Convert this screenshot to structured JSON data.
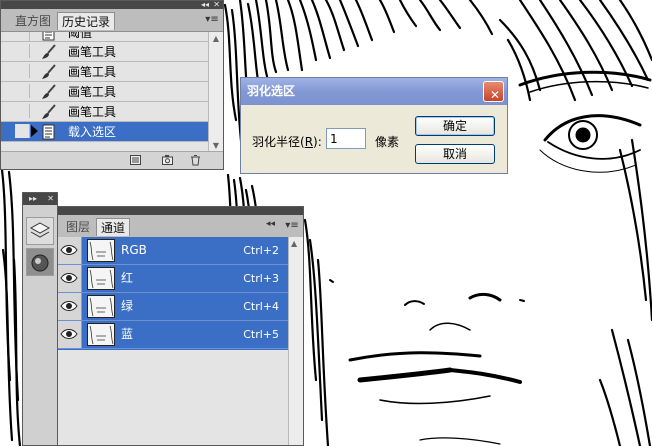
{
  "history_panel": {
    "collapse_glyph": "◂◂",
    "close_glyph": "✕",
    "tabs": [
      {
        "label": "直方图",
        "active": false
      },
      {
        "label": "历史记录",
        "active": true
      }
    ],
    "menu_glyph": "▾≡",
    "items": [
      {
        "label": "阈值",
        "icon": "history-state-icon",
        "selected": false
      },
      {
        "label": "画笔工具",
        "icon": "brush-icon",
        "selected": false
      },
      {
        "label": "画笔工具",
        "icon": "brush-icon",
        "selected": false
      },
      {
        "label": "画笔工具",
        "icon": "brush-icon",
        "selected": false
      },
      {
        "label": "画笔工具",
        "icon": "brush-icon",
        "selected": false
      },
      {
        "label": "载入选区",
        "icon": "history-state-icon",
        "selected": true
      }
    ],
    "footer_icons": [
      "new-document-from-state-icon",
      "snapshot-icon",
      "trash-icon"
    ]
  },
  "tool_strip": {
    "expand_glyph": "▸▸",
    "close_glyph": "✕",
    "buttons": [
      "layers-icon",
      "channels-icon"
    ]
  },
  "channels_panel": {
    "collapse_glyph": "◂◂",
    "tabs": [
      {
        "label": "图层",
        "active": false
      },
      {
        "label": "通道",
        "active": true
      }
    ],
    "menu_glyph": "▾≡",
    "channels": [
      {
        "name": "RGB",
        "shortcut": "Ctrl+2"
      },
      {
        "name": "红",
        "shortcut": "Ctrl+3"
      },
      {
        "name": "绿",
        "shortcut": "Ctrl+4"
      },
      {
        "name": "蓝",
        "shortcut": "Ctrl+5"
      }
    ]
  },
  "feather_dialog": {
    "title": "羽化选区",
    "radius_label_before": "羽化半径(",
    "radius_label_key": "R",
    "radius_label_after": "):",
    "radius_value": "1",
    "unit": "像素",
    "ok_label": "确定",
    "cancel_label": "取消",
    "close_glyph": "✕"
  },
  "colors": {
    "selection_blue": "#3b6fc6",
    "dialog_title": "#8399d5",
    "panel_gray": "#d4d4d4"
  }
}
